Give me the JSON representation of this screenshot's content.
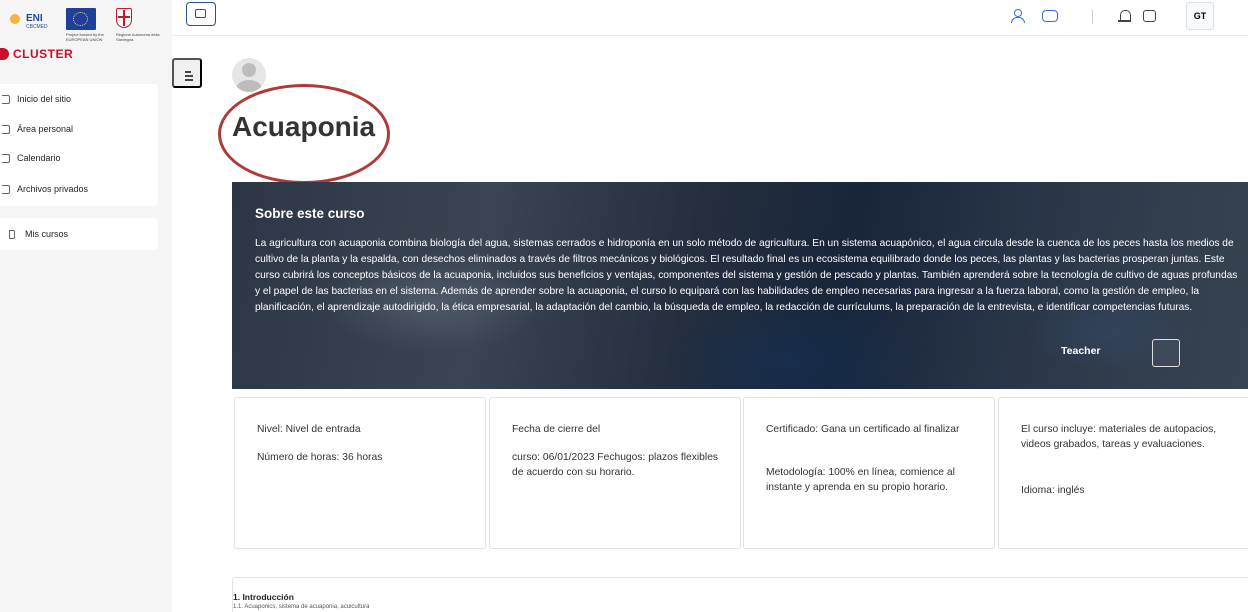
{
  "logos": {
    "eni": "ENI",
    "eni_sub": "CBCMED",
    "eu_caption": "Project funded by the EUROPEAN UNION",
    "crest_caption": "Regione Autonoma della Sardegna"
  },
  "brand": {
    "name": "CLUSTER",
    "color": "#c8102e"
  },
  "sidebar": {
    "items": [
      {
        "label": "Inicio del sitio",
        "icon": "home-icon"
      },
      {
        "label": "Área personal",
        "icon": "dashboard-icon"
      },
      {
        "label": "Calendario",
        "icon": "calendar-icon"
      },
      {
        "label": "Archivos privados",
        "icon": "file-icon"
      }
    ],
    "my_courses": {
      "label": "Mis cursos",
      "icon": "course-icon"
    }
  },
  "topbar": {
    "user_initials": "GT",
    "accent": "#3f6bd8"
  },
  "course": {
    "title": "Acuaponia",
    "hero": {
      "heading": "Sobre este curso",
      "description": "La agricultura con acuaponia combina biología del agua, sistemas cerrados e hidroponía en un solo método de agricultura. En un sistema acuapónico, el agua circula desde la cuenca de los peces hasta los medios de cultivo de la planta y la espalda, con desechos eliminados a través de filtros mecánicos y biológicos. El resultado final es un ecosistema equilibrado donde los peces, las plantas y las bacterias prosperan juntas. Este curso cubrirá los conceptos básicos de la acuaponia, incluidos sus beneficios y ventajas, componentes del sistema y gestión de pescado y plantas. También aprenderá sobre la tecnología de cultivo de aguas profundas y el papel de las bacterias en el sistema. Además de aprender sobre la acuaponia, el curso lo equipará con las habilidades de empleo necesarias para ingresar a la fuerza laboral, como la gestión de empleo, la planificación, el aprendizaje autodirigido, la ética empresarial, la adaptación del cambio, la búsqueda de empleo, la redacción de currículums, la preparación de la entrevista, e identificar competencias futuras.",
      "teacher_label": "Teacher"
    },
    "cards": [
      {
        "line1": "Nivel: Nivel de entrada",
        "line2": "Número de horas: 36 horas"
      },
      {
        "line1": "Fecha de cierre del",
        "line2": "curso: 06/01/2023 Fechugos: plazos flexibles de acuerdo con su horario."
      },
      {
        "line1": "Certificado: Gana un certificado al finalizar",
        "line2": "Metodología: 100% en línea, comience al instante y aprenda en su propio horario."
      },
      {
        "line1": "El curso incluye: materiales de autopacios, videos grabados, tareas y evaluaciones.",
        "line2": "Idioma: inglés"
      }
    ],
    "section": {
      "title": "1. Introducción",
      "subtitle": "1.1. Acuaponics, sistema de acuaponia, acuicultura"
    }
  }
}
